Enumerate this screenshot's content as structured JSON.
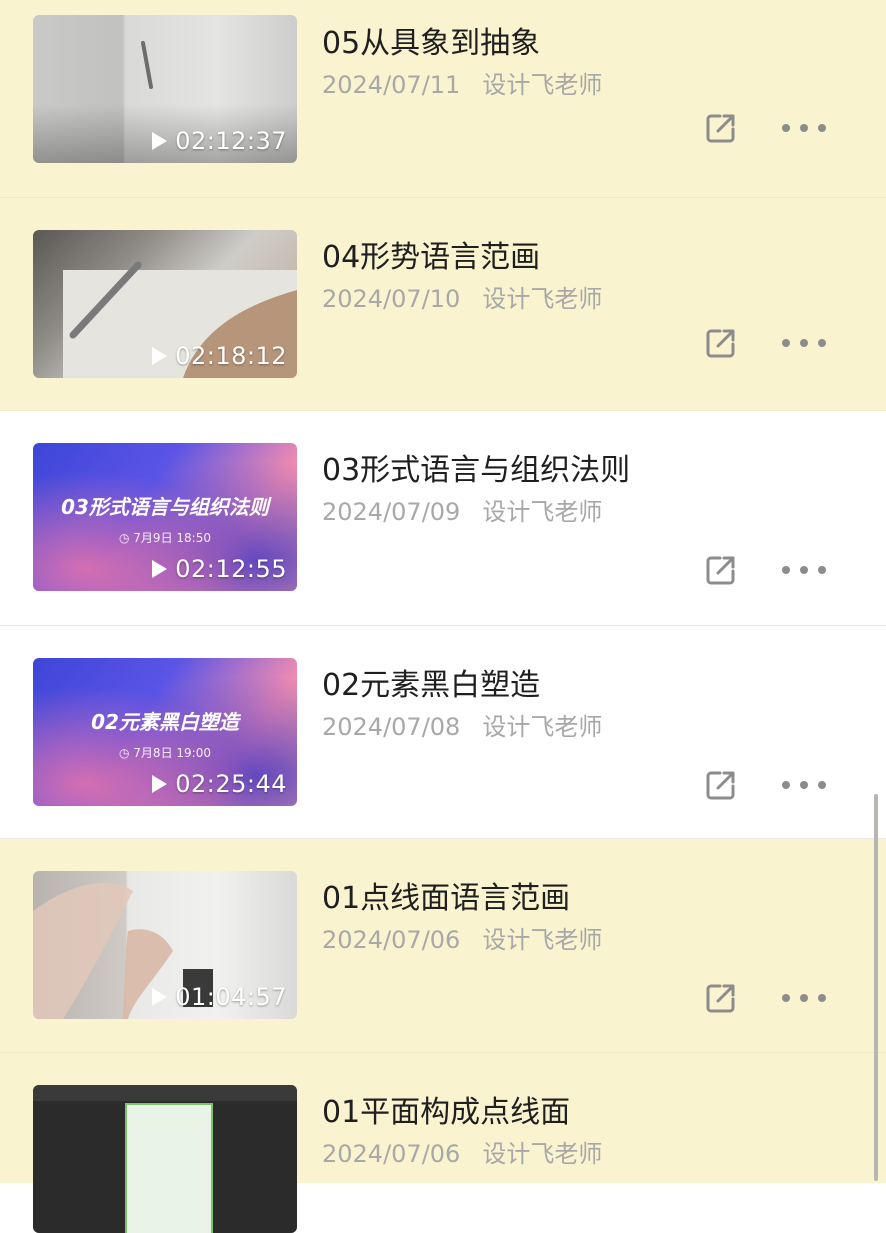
{
  "videos": [
    {
      "title": "05从具象到抽象",
      "date": "2024/07/11",
      "author": "设计飞老师",
      "duration": "02:12:37",
      "thumb_text": "",
      "thumb_sub": ""
    },
    {
      "title": "04形势语言范画",
      "date": "2024/07/10",
      "author": "设计飞老师",
      "duration": "02:18:12",
      "thumb_text": "",
      "thumb_sub": ""
    },
    {
      "title": "03形式语言与组织法则",
      "date": "2024/07/09",
      "author": "设计飞老师",
      "duration": "02:12:55",
      "thumb_text": "03形式语言与组织法则",
      "thumb_sub": "◷ 7月9日 18:50"
    },
    {
      "title": "02元素黑白塑造",
      "date": "2024/07/08",
      "author": "设计飞老师",
      "duration": "02:25:44",
      "thumb_text": "02元素黑白塑造",
      "thumb_sub": "◷ 7月8日 19:00"
    },
    {
      "title": "01点线面语言范画",
      "date": "2024/07/06",
      "author": "设计飞老师",
      "duration": "01:04:57",
      "thumb_text": "",
      "thumb_sub": ""
    },
    {
      "title": "01平面构成点线面",
      "date": "2024/07/06",
      "author": "设计飞老师",
      "duration": "",
      "thumb_text": "",
      "thumb_sub": ""
    }
  ],
  "icons": {
    "share": "share-external-icon",
    "more": "more-horizontal-icon",
    "play": "play-icon"
  },
  "colors": {
    "highlight_bg": "#faf3cf",
    "title": "#1f1f1f",
    "meta": "#a8a8a8",
    "icon": "#8c8c8c"
  }
}
